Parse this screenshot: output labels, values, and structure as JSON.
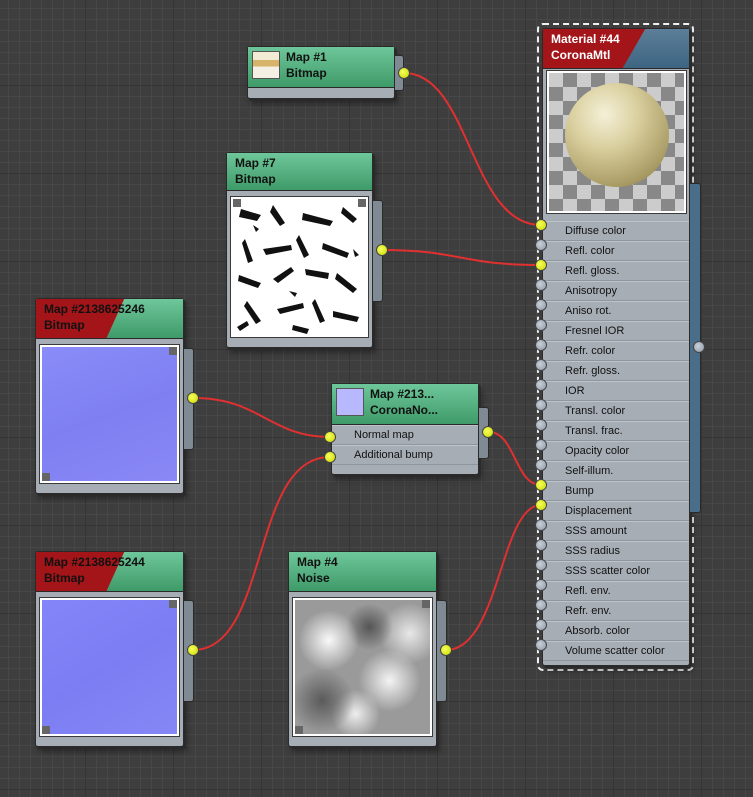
{
  "colors": {
    "wire": "#e03030",
    "socket_connected": "#e6f200",
    "header_green": "#4faf7c",
    "header_red": "#a31519",
    "material_blue": "#3d6582",
    "background": "#3e3e3e"
  },
  "nodes": {
    "map1": {
      "title": "Map #1",
      "type": "Bitmap"
    },
    "map7": {
      "title": "Map #7",
      "type": "Bitmap"
    },
    "map246": {
      "title": "Map #2138625246",
      "type": "Bitmap"
    },
    "map244": {
      "title": "Map #2138625244",
      "type": "Bitmap"
    },
    "normal": {
      "title": "Map #213...",
      "type": "CoronaNo...",
      "collapse": "−",
      "slots": [
        "Normal map",
        "Additional bump"
      ]
    },
    "noise": {
      "title": "Map #4",
      "type": "Noise",
      "expand": "+"
    },
    "material": {
      "title": "Material #44",
      "type": "CoronaMtl",
      "collapse": "−",
      "slots": [
        "Diffuse color",
        "Refl. color",
        "Refl. gloss.",
        "Anisotropy",
        "Aniso rot.",
        "Fresnel IOR",
        "Refr. color",
        "Refr. gloss.",
        "IOR",
        "Transl. color",
        "Transl. frac.",
        "Opacity color",
        "Self-illum.",
        "Bump",
        "Displacement",
        "SSS amount",
        "SSS radius",
        "SSS scatter color",
        "Refl. env.",
        "Refr. env.",
        "Absorb. color",
        "Volume scatter color"
      ],
      "connected_slots": [
        "Diffuse color",
        "Refl. gloss.",
        "Bump",
        "Displacement"
      ]
    }
  }
}
